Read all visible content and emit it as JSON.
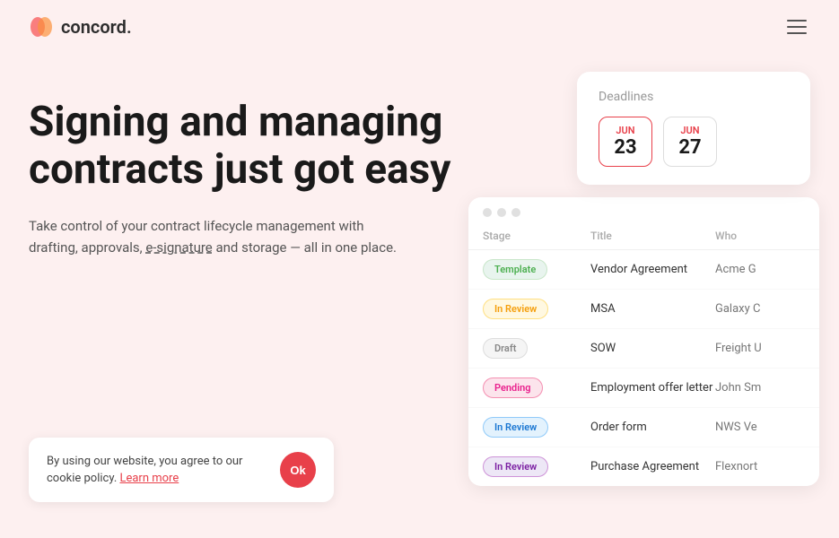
{
  "nav": {
    "logo_text": "concord.",
    "menu_icon": "≡"
  },
  "hero": {
    "headline": "Signing and managing contracts just got easy",
    "subtext": "Take control of your contract lifecycle management with drafting, approvals, e-signature and storage — all in one place."
  },
  "cookie": {
    "text": "By using our website, you agree to our cookie policy.",
    "link": "Learn more",
    "button": "Ok"
  },
  "deadlines_card": {
    "title": "Deadlines",
    "dates": [
      {
        "month": "Jun",
        "day": "23",
        "active": true
      },
      {
        "month": "Jun",
        "day": "27",
        "active": false
      }
    ]
  },
  "table_card": {
    "columns": [
      "Stage",
      "Title",
      "Who"
    ],
    "rows": [
      {
        "stage": "Template",
        "stage_type": "template",
        "title": "Vendor Agreement",
        "who": "Acme G"
      },
      {
        "stage": "In Review",
        "stage_type": "in-review-yellow",
        "title": "MSA",
        "who": "Galaxy C"
      },
      {
        "stage": "Draft",
        "stage_type": "draft",
        "title": "SOW",
        "who": "Freight U"
      },
      {
        "stage": "Pending",
        "stage_type": "pending",
        "title": "Employment offer letter",
        "who": "John Sm"
      },
      {
        "stage": "In Review",
        "stage_type": "in-review-blue",
        "title": "Order form",
        "who": "NWS Ve"
      },
      {
        "stage": "In Review",
        "stage_type": "in-review-purple",
        "title": "Purchase Agreement",
        "who": "Flexnort"
      }
    ]
  }
}
